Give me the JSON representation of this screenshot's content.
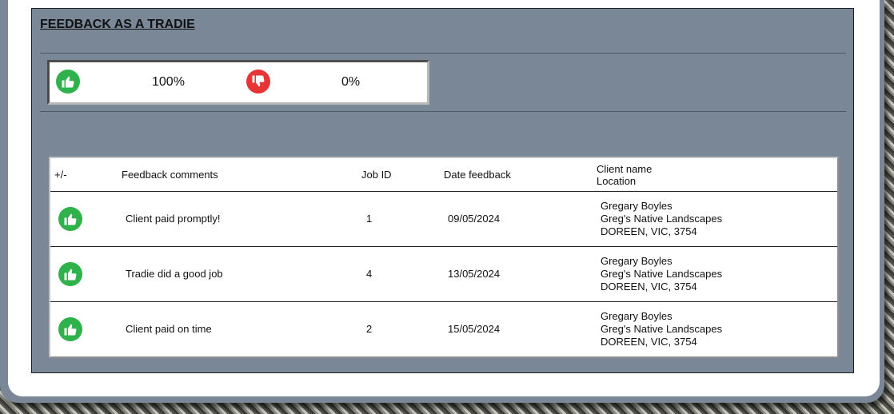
{
  "section": {
    "title": "FEEDBACK AS A TRADIE"
  },
  "summary": {
    "positive_pct": "100%",
    "negative_pct": "0%",
    "positive_icon": "thumbs-up-icon",
    "negative_icon": "thumbs-down-icon"
  },
  "table": {
    "headers": {
      "rating": "+/-",
      "comments": "Feedback comments",
      "job_id": "Job ID",
      "date": "Date feedback",
      "client_name": "Client name",
      "location": "Location"
    },
    "rows": [
      {
        "rating": "positive",
        "comment": "Client paid promptly!",
        "job_id": "1",
        "date": "09/05/2024",
        "client_name": "Gregary Boyles",
        "business": "Greg's Native Landscapes",
        "location": "DOREEN, VIC, 3754"
      },
      {
        "rating": "positive",
        "comment": "Tradie did a good job",
        "job_id": "4",
        "date": "13/05/2024",
        "client_name": "Gregary Boyles",
        "business": "Greg's Native Landscapes",
        "location": "DOREEN, VIC, 3754"
      },
      {
        "rating": "positive",
        "comment": "Client paid on time",
        "job_id": "2",
        "date": "15/05/2024",
        "client_name": "Gregary Boyles",
        "business": "Greg's Native Landscapes",
        "location": "DOREEN, VIC, 3754"
      }
    ]
  },
  "colors": {
    "panel_bg": "#798797",
    "positive": "#2fb24b",
    "negative": "#e53535"
  }
}
